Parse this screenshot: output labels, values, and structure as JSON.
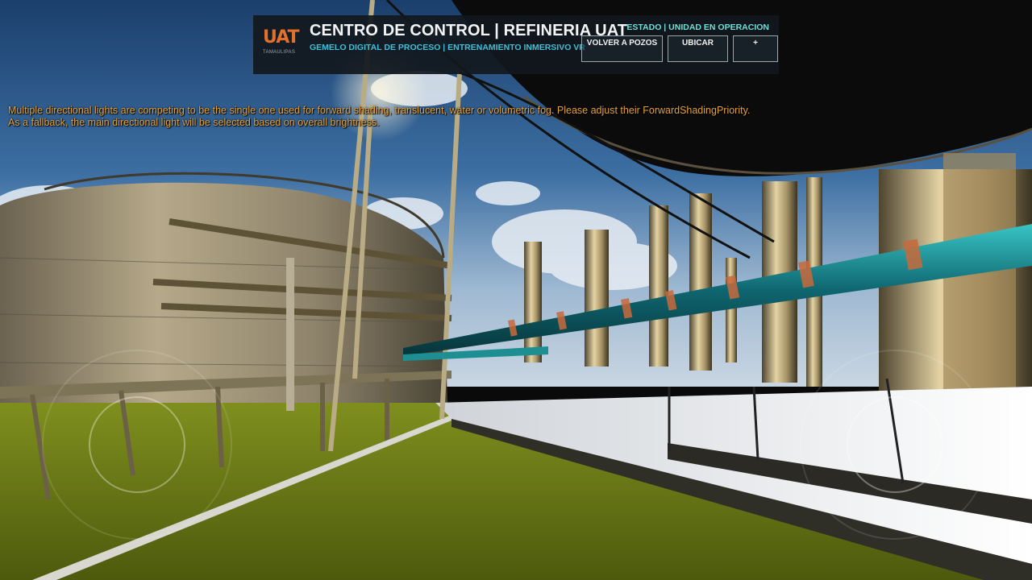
{
  "hud": {
    "logo_text": "UAT",
    "logo_sub": "TAMAULIPAS",
    "title": "CENTRO DE CONTROL | REFINERIA UAT",
    "subtitle": "GEMELO DIGITAL DE PROCESO | ENTRENAMIENTO INMERSIVO VR",
    "status": "ESTADO | UNIDAD EN OPERACION",
    "buttons": {
      "volver": "VOLVER A POZOS",
      "ubicar": "UBICAR",
      "more": "+"
    }
  },
  "engine_warning": {
    "line1": "Multiple directional lights are competing to be the single one used for forward shading, translucent, water or volumetric fog. Please adjust their ForwardShadingPriority.",
    "line2": "As a fallback, the main directional light will be selected based on overall brightness."
  },
  "colors": {
    "brand_orange": "#e0702c",
    "accent_cyan": "#3ec0d8",
    "status_teal": "#6de0d8",
    "warning_amber": "#e6a23a"
  }
}
